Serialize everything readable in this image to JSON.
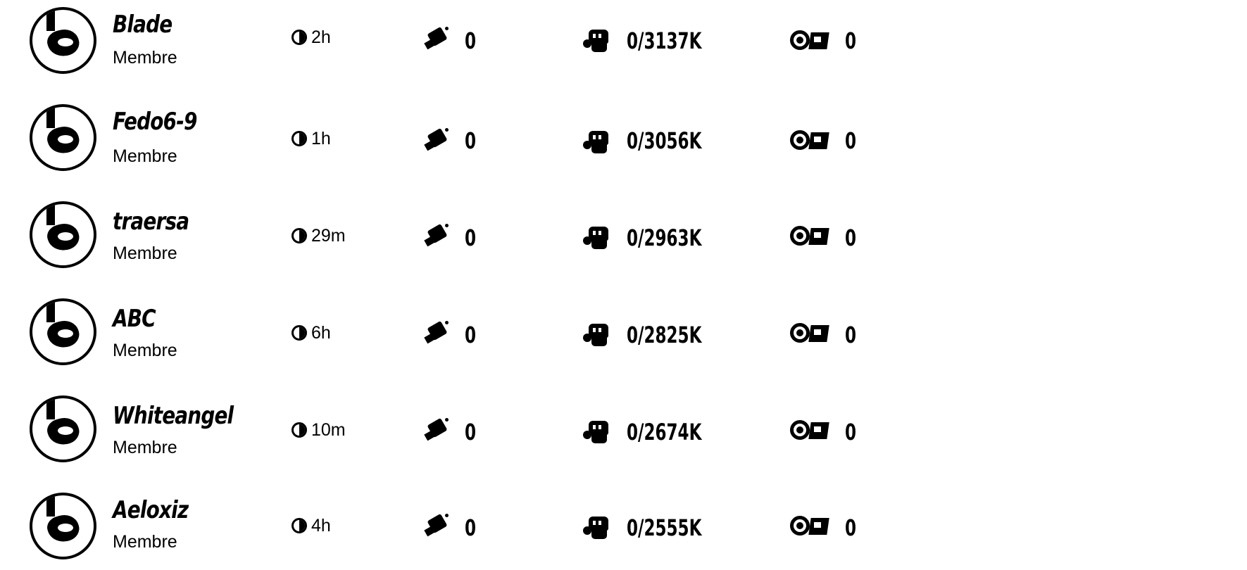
{
  "rows": [
    {
      "name": "Blade",
      "role": "Membre",
      "time": "2h",
      "keys": "0",
      "power": "0/3137K",
      "gear": "0"
    },
    {
      "name": "Fedo6-9",
      "role": "Membre",
      "time": "1h",
      "keys": "0",
      "power": "0/3056K",
      "gear": "0"
    },
    {
      "name": "traersa",
      "role": "Membre",
      "time": "29m",
      "keys": "0",
      "power": "0/2963K",
      "gear": "0"
    },
    {
      "name": "ABC",
      "role": "Membre",
      "time": "6h",
      "keys": "0",
      "power": "0/2825K",
      "gear": "0"
    },
    {
      "name": "Whiteangel",
      "role": "Membre",
      "time": "10m",
      "keys": "0",
      "power": "0/2674K",
      "gear": "0"
    },
    {
      "name": "Aeloxiz",
      "role": "Membre",
      "time": "4h",
      "keys": "0",
      "power": "0/2555K",
      "gear": "0"
    }
  ],
  "icons": {
    "avatar": "avatar-icon",
    "time": "clock-icon",
    "keys": "key-icon",
    "power": "fist-icon",
    "gear": "gear-icon"
  }
}
